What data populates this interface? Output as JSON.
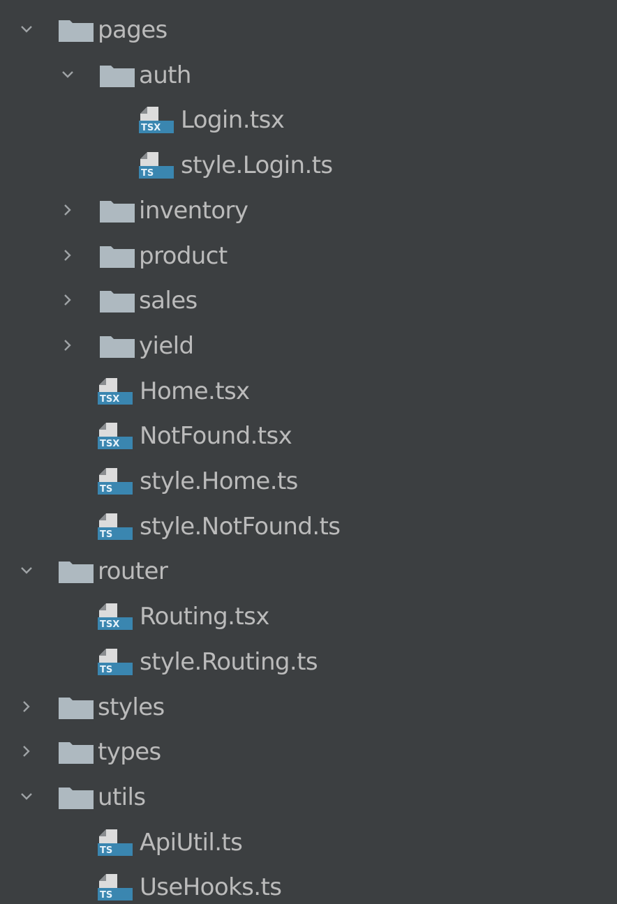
{
  "theme": {
    "background": "#3c3f41",
    "text": "#bbbbbb",
    "folder": "#aeb9c0",
    "chevron": "#9fa3a6",
    "ts_badge": "#3a86b0",
    "file_sheet": "#dcdcdc"
  },
  "tree": [
    {
      "label": "pages",
      "kind": "folder",
      "expanded": true,
      "depth": 0
    },
    {
      "label": "auth",
      "kind": "folder",
      "expanded": true,
      "depth": 1
    },
    {
      "label": "Login.tsx",
      "kind": "tsx",
      "depth": 2
    },
    {
      "label": "style.Login.ts",
      "kind": "ts",
      "depth": 2
    },
    {
      "label": "inventory",
      "kind": "folder",
      "expanded": false,
      "depth": 1
    },
    {
      "label": "product",
      "kind": "folder",
      "expanded": false,
      "depth": 1
    },
    {
      "label": "sales",
      "kind": "folder",
      "expanded": false,
      "depth": 1
    },
    {
      "label": "yield",
      "kind": "folder",
      "expanded": false,
      "depth": 1
    },
    {
      "label": "Home.tsx",
      "kind": "tsx",
      "depth": 1
    },
    {
      "label": "NotFound.tsx",
      "kind": "tsx",
      "depth": 1
    },
    {
      "label": "style.Home.ts",
      "kind": "ts",
      "depth": 1
    },
    {
      "label": "style.NotFound.ts",
      "kind": "ts",
      "depth": 1
    },
    {
      "label": "router",
      "kind": "folder",
      "expanded": true,
      "depth": 0
    },
    {
      "label": "Routing.tsx",
      "kind": "tsx",
      "depth": 1
    },
    {
      "label": "style.Routing.ts",
      "kind": "ts",
      "depth": 1
    },
    {
      "label": "styles",
      "kind": "folder",
      "expanded": false,
      "depth": 0
    },
    {
      "label": "types",
      "kind": "folder",
      "expanded": false,
      "depth": 0
    },
    {
      "label": "utils",
      "kind": "folder",
      "expanded": true,
      "depth": 0
    },
    {
      "label": "ApiUtil.ts",
      "kind": "ts",
      "depth": 1
    },
    {
      "label": "UseHooks.ts",
      "kind": "ts",
      "depth": 1
    }
  ]
}
